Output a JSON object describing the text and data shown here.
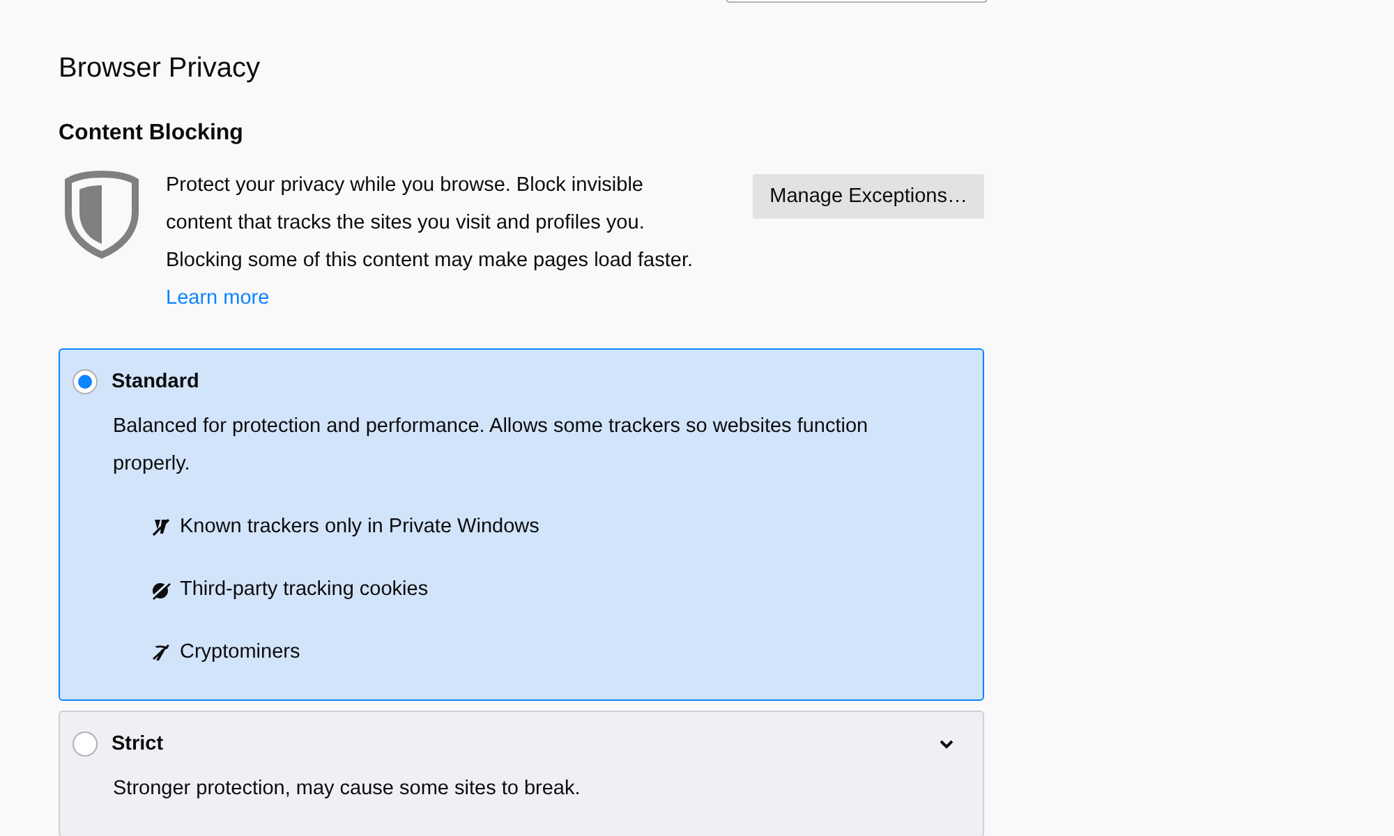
{
  "section_title": "Browser Privacy",
  "content_blocking": {
    "title": "Content Blocking",
    "description": "Protect your privacy while you browse. Block invisible content that tracks the sites you visit and profiles you. Blocking some of this content may make pages load faster.",
    "learn_more": "Learn more",
    "manage_button": "Manage Exceptions…"
  },
  "options": [
    {
      "label": "Standard",
      "selected": true,
      "expanded": true,
      "description": "Balanced for protection and performance. Allows some trackers so websites function properly.",
      "items": [
        {
          "kind": "trackers",
          "label": "Known trackers only in Private Windows"
        },
        {
          "kind": "cookies",
          "label": "Third-party tracking cookies"
        },
        {
          "kind": "cryptominers",
          "label": "Cryptominers"
        }
      ]
    },
    {
      "label": "Strict",
      "selected": false,
      "expanded": false,
      "description": "Stronger protection, may cause some sites to break."
    }
  ]
}
